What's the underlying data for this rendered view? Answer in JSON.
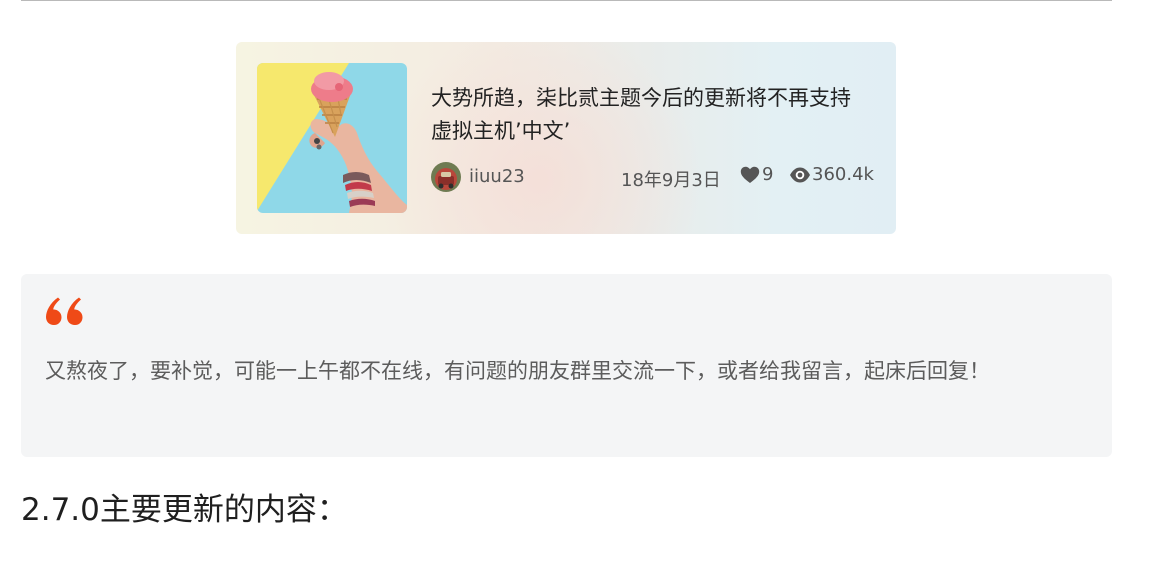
{
  "card": {
    "title": "大势所趋，柒比贰主题今后的更新将不再支持虚拟主机’中文’",
    "author": "iiuu23",
    "date": "18年9月3日",
    "likes": "9",
    "views": "360.4k",
    "icons": {
      "thumbnail": "ice-cream-image",
      "avatar": "avatar-image",
      "likes": "heart-icon",
      "views": "eye-icon"
    }
  },
  "quote": {
    "text": "又熬夜了，要补觉，可能一上午都不在线，有问题的朋友群里交流一下，或者给我留言，起床后回复！",
    "icon": "quote-icon",
    "accent_color": "#ef4a17"
  },
  "heading": {
    "text": "2.7.0主要更新的内容："
  }
}
